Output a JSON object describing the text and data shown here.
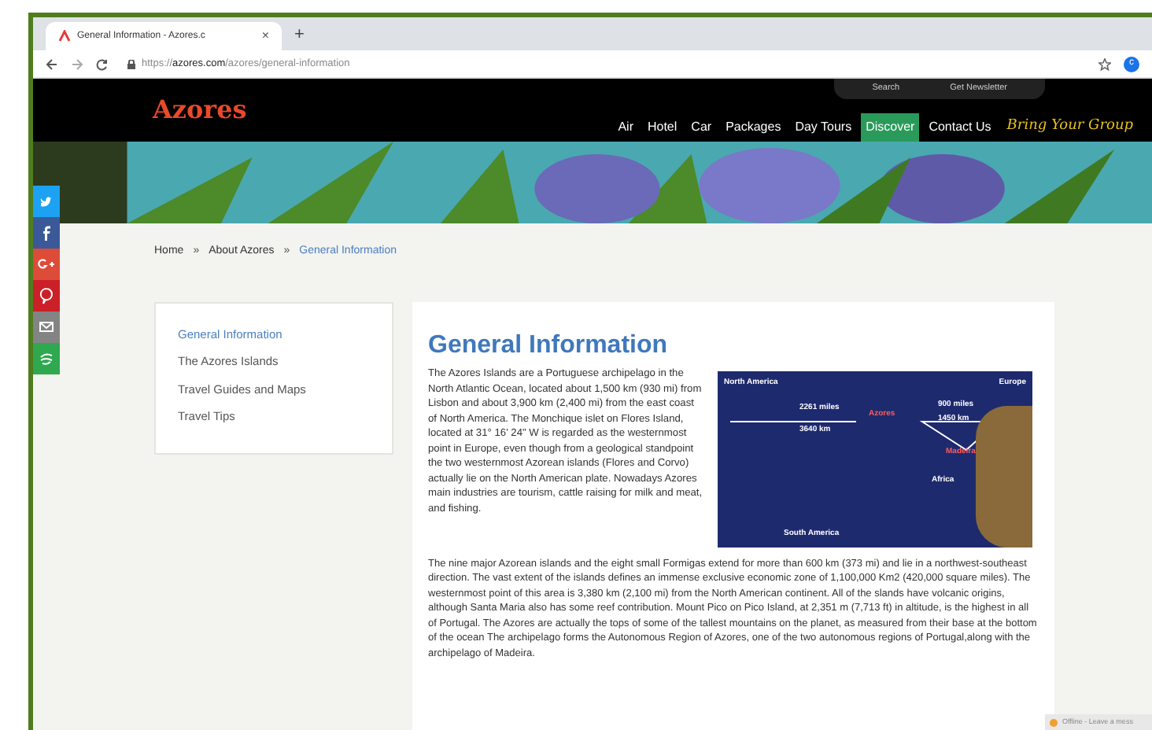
{
  "browser": {
    "tab_title": "General Information - Azores.c",
    "tab_close": "×",
    "new_tab": "+",
    "url_prefix": "https://",
    "url_domain": "azores.com",
    "url_path": "/azores/general-information",
    "profile_initial": "c"
  },
  "header": {
    "logo": "Azores",
    "utility": [
      {
        "label": "Search"
      },
      {
        "label": "Get Newsletter"
      }
    ],
    "nav": [
      {
        "label": "Air",
        "selected": false
      },
      {
        "label": "Hotel",
        "selected": false
      },
      {
        "label": "Car",
        "selected": false
      },
      {
        "label": "Packages",
        "selected": false
      },
      {
        "label": "Day Tours",
        "selected": false
      },
      {
        "label": "Discover",
        "selected": true
      },
      {
        "label": "Contact Us",
        "selected": false
      }
    ],
    "promo": "Bring Your Group"
  },
  "share": [
    {
      "kind": "twitter",
      "color": "#1da1f2"
    },
    {
      "kind": "facebook",
      "color": "#3b5998"
    },
    {
      "kind": "googleplus",
      "color": "#dd4b39"
    },
    {
      "kind": "pinterest",
      "color": "#cb2027"
    },
    {
      "kind": "email",
      "color": "#848484"
    },
    {
      "kind": "sharethis",
      "color": "#2fa84f"
    }
  ],
  "breadcrumb": {
    "items": [
      "Home",
      "About Azores",
      "General Information"
    ],
    "separator": "»"
  },
  "sidebar": [
    {
      "label": "General Information",
      "selected": true
    },
    {
      "label": "The Azores Islands",
      "selected": false
    },
    {
      "label": "Travel Guides and Maps",
      "selected": false
    },
    {
      "label": "Travel Tips",
      "selected": false
    }
  ],
  "article": {
    "title": "General Information",
    "paragraphs": [
      "The Azores Islands are a Portuguese archipelago in the North Atlantic Ocean, located about 1,500 km (930 mi) from Lisbon and about 3,900 km (2,400 mi) from the east coast of North America. The Monchique islet on Flores Island, located at 31° 16' 24\" W is regarded as the westernmost point in Europe, even though from a geological standpoint the two westernmost Azorean islands (Flores and Corvo) actually lie on the North American plate. Nowadays Azores main industries are tourism, cattle raising for milk and meat, and fishing.",
      "The nine major Azorean islands and the eight small Formigas extend for more than 600 km (373 mi) and lie in a northwest-southeast direction. The vast extent of the islands defines an immense exclusive economic zone of 1,100,000 Km2 (420,000 square miles). The westernmost point of this area is 3,380 km (2,100 mi) from the North American continent. All of the slands have volcanic origins, although Santa Maria also has some reef contribution. Mount Pico on Pico Island, at 2,351 m (7,713 ft) in altitude, is the highest in all of Portugal. The Azores are actually the tops of some of the tallest mountains on the planet, as measured from their base at the bottom of the ocean The archipelago forms the Autonomous Region of Azores, one of the two autonomous regions of Portugal,along with the archipelago of Madeira."
    ],
    "map": {
      "labels": [
        {
          "text": "North America",
          "kind": "continent"
        },
        {
          "text": "Europe",
          "kind": "continent"
        },
        {
          "text": "2261 miles",
          "kind": "distance-top"
        },
        {
          "text": "3640 km",
          "kind": "distance-bottom"
        },
        {
          "text": "Azores",
          "kind": "island"
        },
        {
          "text": "900 miles",
          "kind": "distance-top2"
        },
        {
          "text": "1450 km",
          "kind": "distance-bottom2"
        },
        {
          "text": "Madeira",
          "kind": "island2"
        },
        {
          "text": "Africa",
          "kind": "continent2"
        },
        {
          "text": "South America",
          "kind": "continent3"
        }
      ]
    }
  },
  "chat": {
    "label": "Offline - Leave a mess"
  }
}
